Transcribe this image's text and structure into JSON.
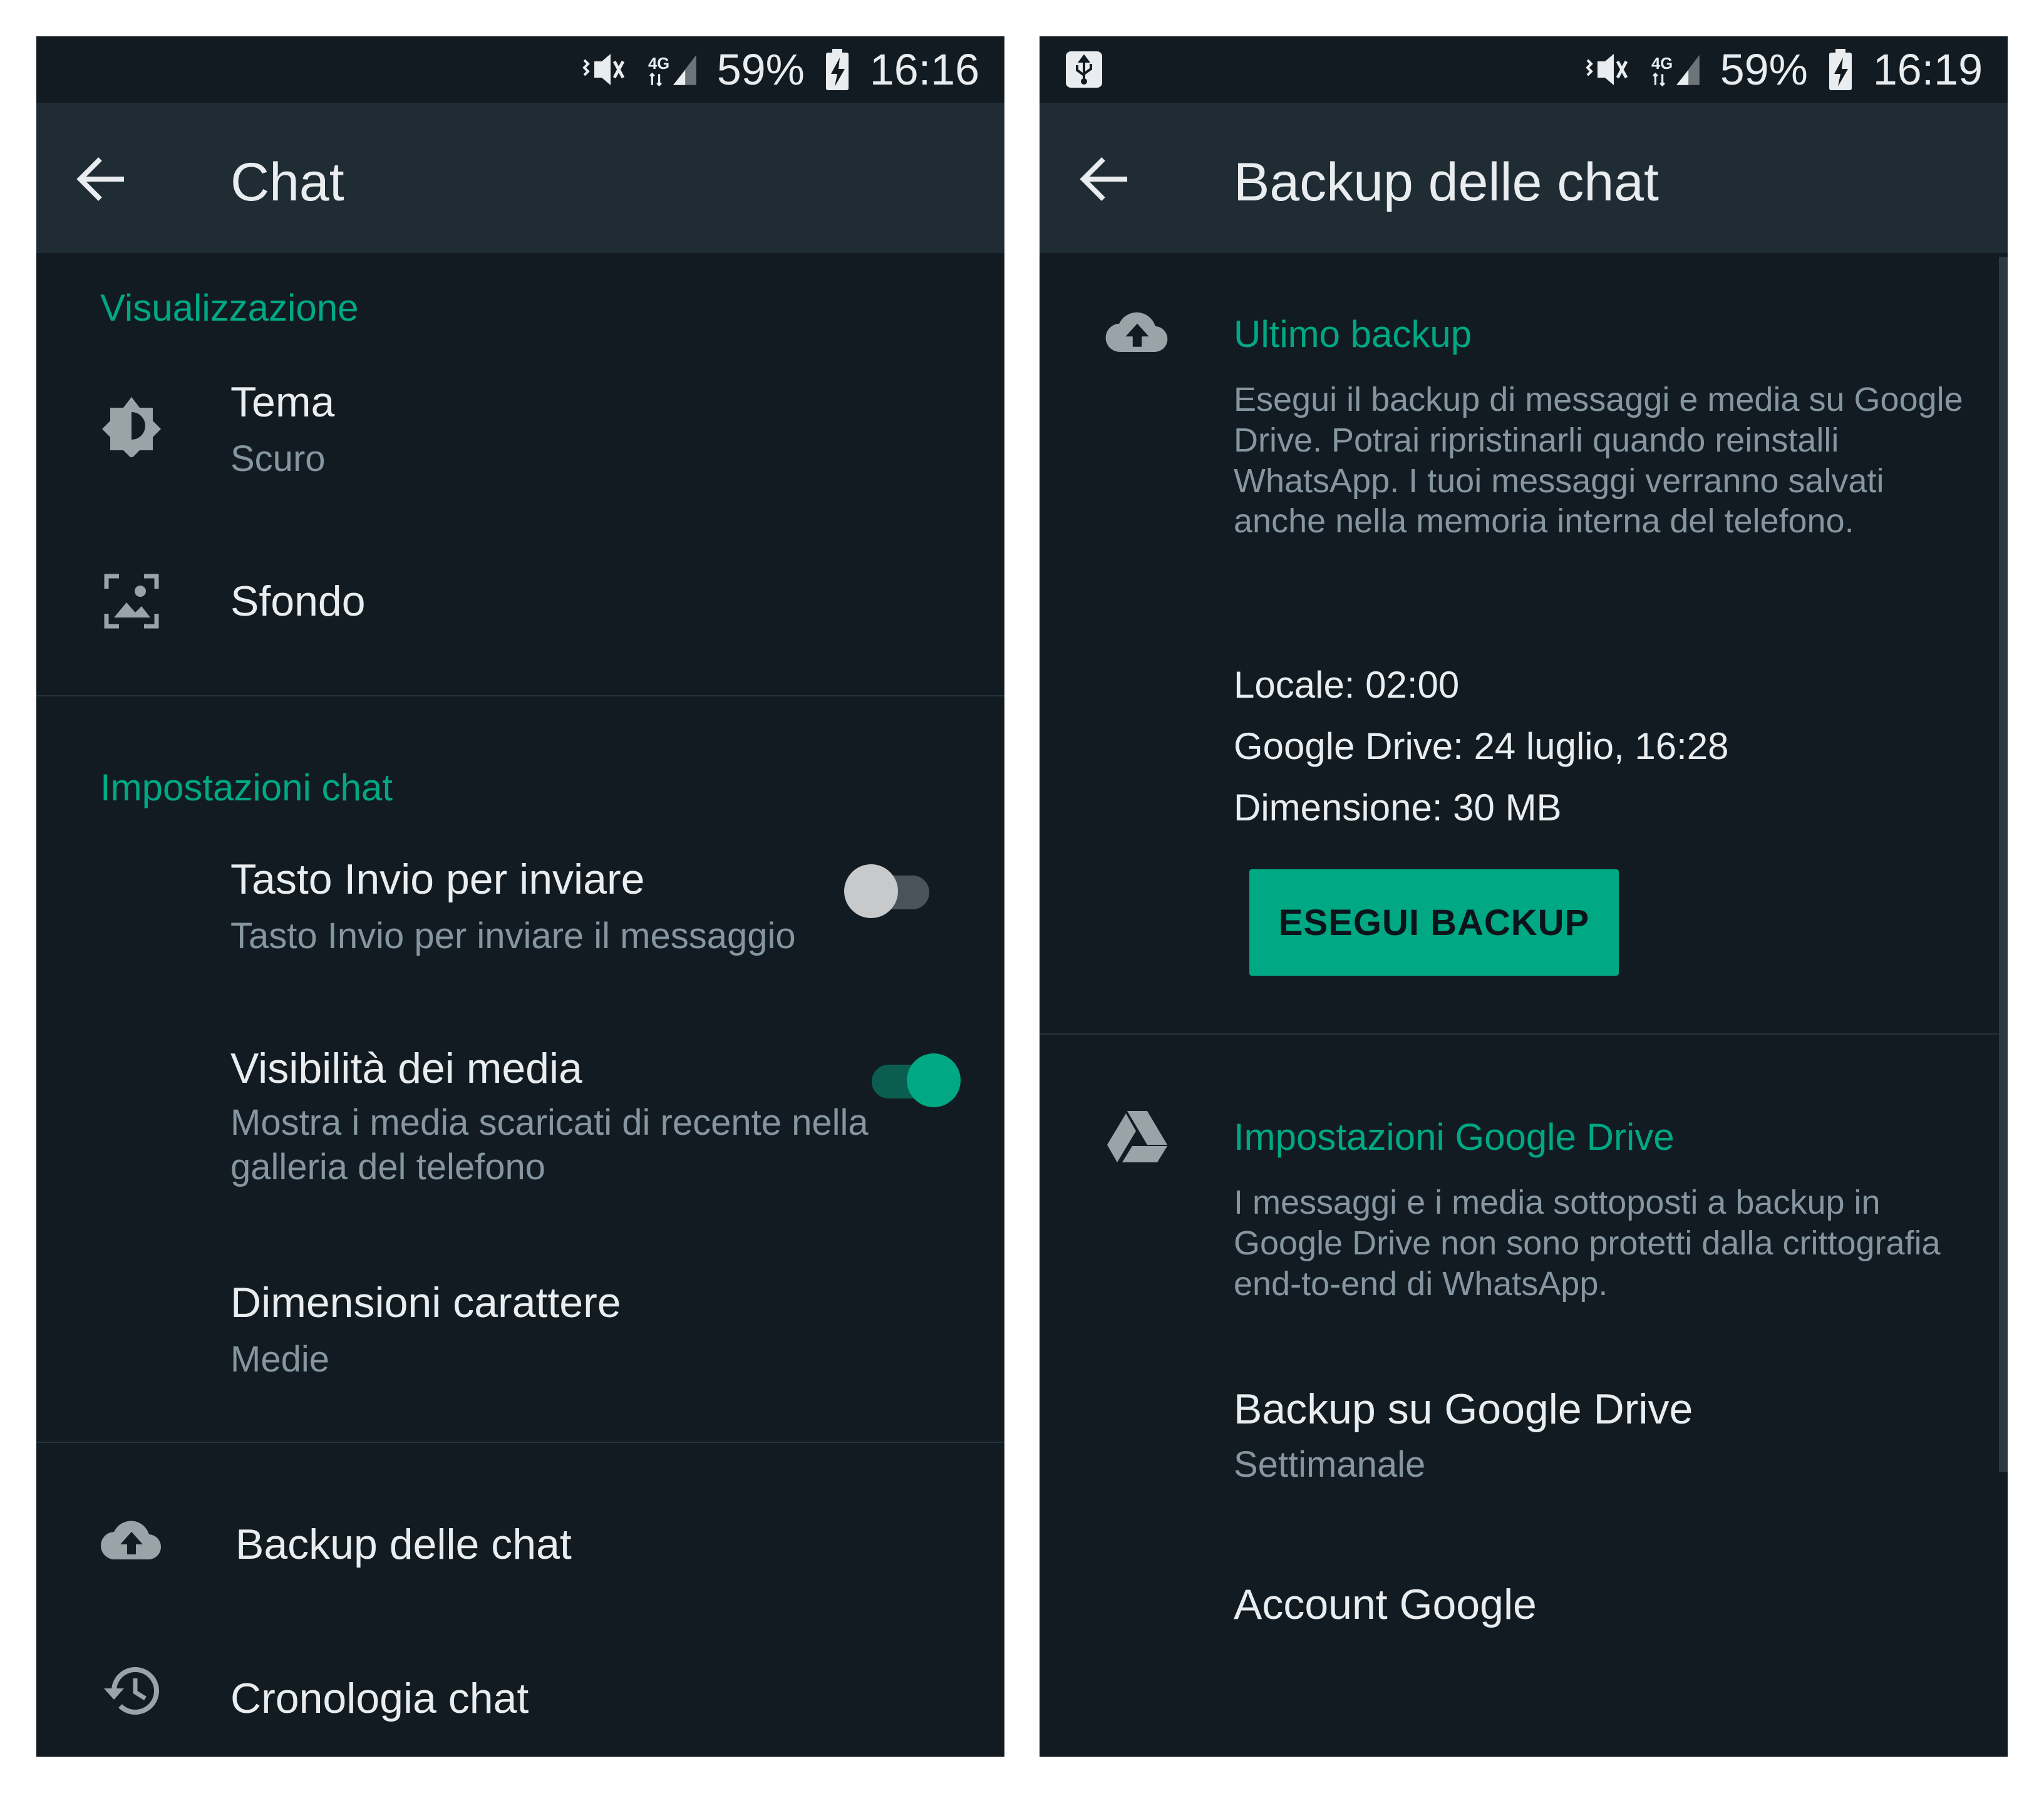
{
  "left": {
    "status": {
      "battery": "59%",
      "time": "16:16"
    },
    "appbar": {
      "title": "Chat"
    },
    "sections": {
      "display": "Visualizzazione",
      "chat_settings": "Impostazioni chat"
    },
    "items": {
      "tema": {
        "title": "Tema",
        "subtitle": "Scuro"
      },
      "sfondo": {
        "title": "Sfondo"
      },
      "invio": {
        "title": "Tasto Invio per inviare",
        "subtitle": "Tasto Invio per inviare il messaggio",
        "enabled": false
      },
      "media": {
        "title": "Visibilità dei media",
        "subtitle": "Mostra i media scaricati di recente nella galleria del telefono",
        "enabled": true
      },
      "font_size": {
        "title": "Dimensioni carattere",
        "subtitle": "Medie"
      },
      "backup": {
        "title": "Backup delle chat"
      },
      "history": {
        "title": "Cronologia chat"
      }
    }
  },
  "right": {
    "status": {
      "battery": "59%",
      "time": "16:19"
    },
    "appbar": {
      "title": "Backup delle chat"
    },
    "last_backup": {
      "header": "Ultimo backup",
      "description": "Esegui il backup di messaggi e media su Google Drive. Potrai ripristinarli quando reinstalli WhatsApp. I tuoi messaggi verranno salvati anche nella memoria interna del telefono.",
      "local": "Locale: 02:00",
      "drive": "Google Drive: 24 luglio, 16:28",
      "size": "Dimensione: 30 MB",
      "button": "ESEGUI BACKUP"
    },
    "drive_settings": {
      "header": "Impostazioni Google Drive",
      "description": "I messaggi e i media sottoposti a backup in Google Drive non sono protetti dalla crittografia end-to-end di WhatsApp.",
      "backup_title": "Backup su Google Drive",
      "backup_frequency": "Settimanale",
      "account_title": "Account Google"
    }
  },
  "colors": {
    "background": "#121b22",
    "appbar": "#1f2c34",
    "accent": "#00a884",
    "primary_text": "#e9edef",
    "secondary_text": "#8696a0"
  }
}
